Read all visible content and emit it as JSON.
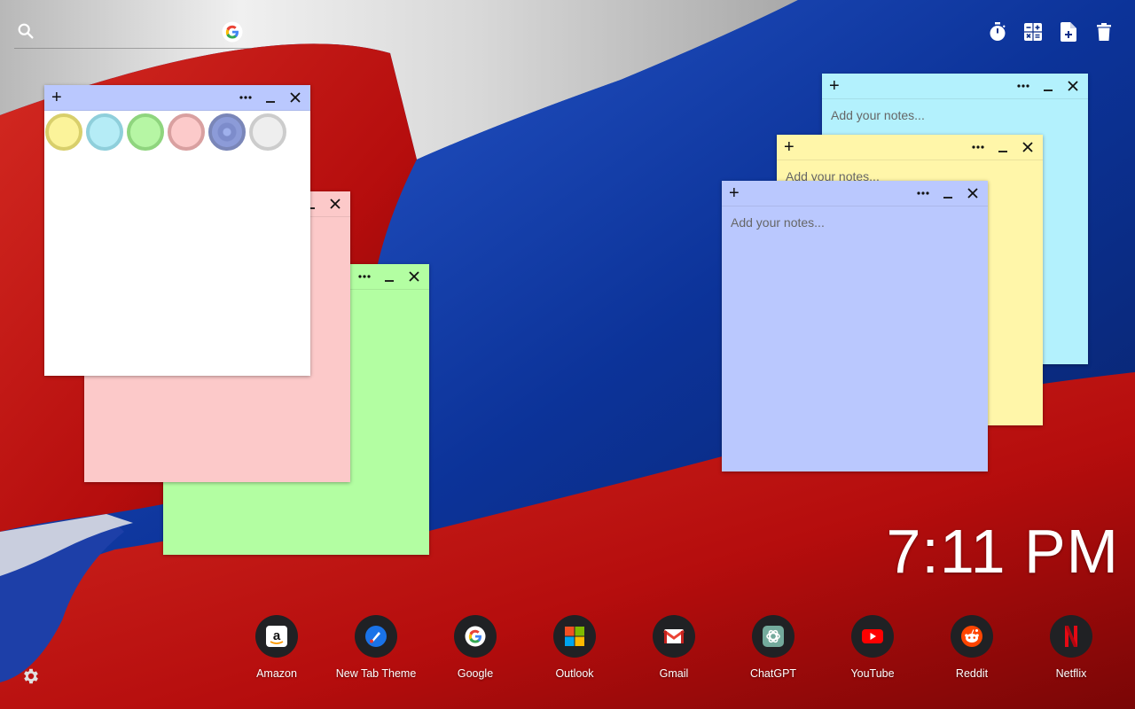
{
  "search": {
    "value": "",
    "placeholder": ""
  },
  "tools": [
    {
      "name": "timer-icon"
    },
    {
      "name": "calculator-icon"
    },
    {
      "name": "add-note-icon"
    },
    {
      "name": "trash-icon"
    }
  ],
  "notes": {
    "white": {
      "color": "#ffffff",
      "palette": [
        "#fbf39a",
        "#b5ecf6",
        "#b6f6a4",
        "#fccaca",
        "#bcc8f5",
        "#eeeeee"
      ],
      "palette_borders": [
        "#d8cf6b",
        "#8fcfdb",
        "#8fd57e",
        "#d9a0a0",
        "#7a86b8",
        "#cccccc"
      ]
    },
    "pink": {
      "color": "#fcc9c9"
    },
    "green": {
      "color": "#b3fea2"
    },
    "cyan": {
      "color": "#b3f1fd",
      "placeholder": "Add your notes..."
    },
    "yellow": {
      "color": "#fff6a9",
      "placeholder": "Add your notes..."
    },
    "blue": {
      "color": "#bac8fe",
      "placeholder": "Add your notes..."
    }
  },
  "clock": {
    "time": "7:11 PM"
  },
  "shortcuts": [
    {
      "label": "Amazon",
      "icon": "amazon-icon"
    },
    {
      "label": "New Tab Theme",
      "icon": "new-tab-theme-icon"
    },
    {
      "label": "Google",
      "icon": "google-icon"
    },
    {
      "label": "Outlook",
      "icon": "outlook-icon"
    },
    {
      "label": "Gmail",
      "icon": "gmail-icon"
    },
    {
      "label": "ChatGPT",
      "icon": "chatgpt-icon"
    },
    {
      "label": "YouTube",
      "icon": "youtube-icon"
    },
    {
      "label": "Reddit",
      "icon": "reddit-icon"
    },
    {
      "label": "Netflix",
      "icon": "netflix-icon"
    }
  ]
}
